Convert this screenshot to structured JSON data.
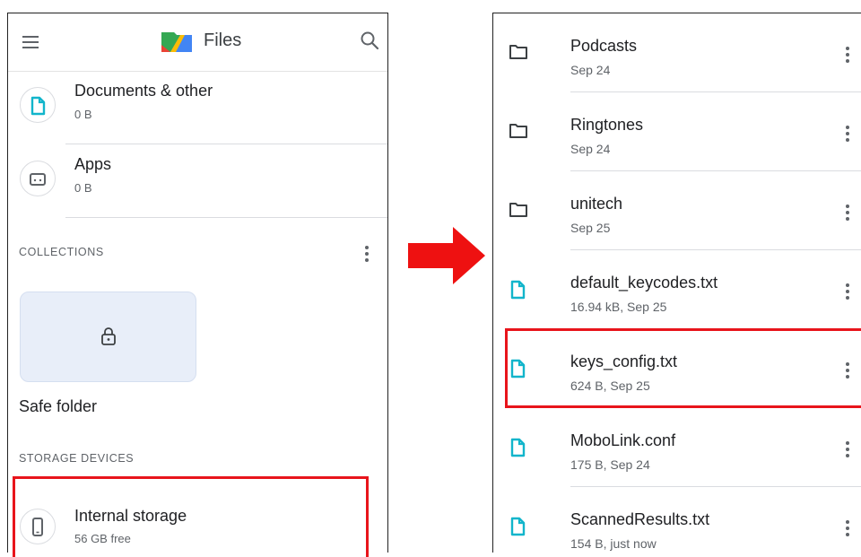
{
  "left": {
    "header": {
      "title": "Files"
    },
    "categories": [
      {
        "title": "Documents & other",
        "size": "0 B",
        "icon": "document-icon"
      },
      {
        "title": "Apps",
        "size": "0 B",
        "icon": "android-icon"
      }
    ],
    "collections": {
      "label": "COLLECTIONS",
      "safe_folder_label": "Safe folder"
    },
    "storage_devices": {
      "label": "STORAGE DEVICES",
      "internal": {
        "title": "Internal storage",
        "subtitle": "56 GB free",
        "icon": "phone-icon"
      }
    }
  },
  "right": {
    "files": [
      {
        "name": "Podcasts",
        "meta": "Sep 24",
        "type": "folder"
      },
      {
        "name": "Ringtones",
        "meta": "Sep 24",
        "type": "folder"
      },
      {
        "name": "unitech",
        "meta": "Sep 25",
        "type": "folder"
      },
      {
        "name": "default_keycodes.txt",
        "meta": "16.94 kB, Sep 25",
        "type": "file"
      },
      {
        "name": "keys_config.txt",
        "meta": "624 B, Sep 25",
        "type": "file",
        "highlighted": true
      },
      {
        "name": "MoboLink.conf",
        "meta": "175 B, Sep 24",
        "type": "file"
      },
      {
        "name": "ScannedResults.txt",
        "meta": "154 B, just now",
        "type": "file"
      }
    ]
  },
  "colors": {
    "highlight": "#e8141b",
    "accent_teal": "#12b5cb",
    "arrow": "#ee1111"
  }
}
